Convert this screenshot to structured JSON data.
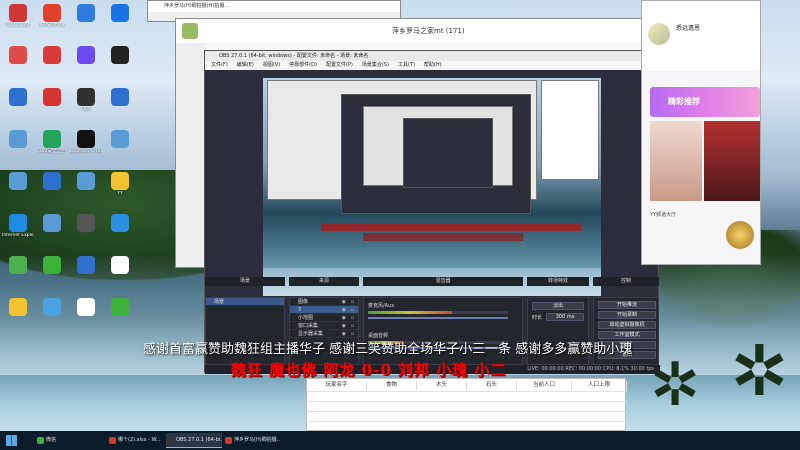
{
  "desktop_icons": [
    {
      "label": "Riot Client",
      "color": "#d13639"
    },
    {
      "label": "WPS Office",
      "color": "#e2412c"
    },
    {
      "label": "",
      "color": "#2f7de1"
    },
    {
      "label": "",
      "color": "#1a73e8"
    },
    {
      "label": "",
      "color": "#e04b4b"
    },
    {
      "label": "",
      "color": "#da3a3a"
    },
    {
      "label": "",
      "color": "#6a4cf0"
    },
    {
      "label": "",
      "color": "#222222"
    },
    {
      "label": "",
      "color": "#2f6fd0"
    },
    {
      "label": "",
      "color": "#d63333"
    },
    {
      "label": "OBS",
      "color": "#303030"
    },
    {
      "label": "",
      "color": "#2f6fd0"
    },
    {
      "label": "",
      "color": "#5b9bd5"
    },
    {
      "label": "360安全卫士",
      "color": "#23a35a"
    },
    {
      "label": "Logitech G HUB",
      "color": "#111111"
    },
    {
      "label": "",
      "color": "#5b9bd5"
    },
    {
      "label": "",
      "color": "#5b9bd5"
    },
    {
      "label": "",
      "color": "#2f6fd0"
    },
    {
      "label": "",
      "color": "#5b9bd5"
    },
    {
      "label": "YY",
      "color": "#f2c230"
    },
    {
      "label": "Internet Explorer",
      "color": "#1f8ae0"
    },
    {
      "label": "",
      "color": "#5b9bd5"
    },
    {
      "label": "",
      "color": "#555555"
    },
    {
      "label": "",
      "color": "#2b8fe0"
    },
    {
      "label": "",
      "color": "#4caf50"
    },
    {
      "label": "",
      "color": "#3db339"
    },
    {
      "label": "",
      "color": "#2f6fd0"
    },
    {
      "label": "",
      "color": "#ffffff"
    },
    {
      "label": "",
      "color": "#f2c230"
    },
    {
      "label": "",
      "color": "#4aa3df"
    },
    {
      "label": "",
      "color": "#ffffff"
    },
    {
      "label": "",
      "color": "#3db339"
    }
  ],
  "taskbar": {
    "items": [
      {
        "label": "哪个(2).xlsx - W...",
        "color": "#d63a2a"
      },
      {
        "label": "OBS 27.0.1 (64-bi...",
        "color": "#333333"
      },
      {
        "label": "萍乡罗马(H)卿拍摄...",
        "color": "#d63a2a"
      }
    ],
    "apps": [
      {
        "label": "微信",
        "color": "#3db339"
      }
    ]
  },
  "browser_window": {
    "title": "萍乡罗马(H)卿拍摄(H)拍摄...",
    "group_title": "萍乡罗马之家mt (171)"
  },
  "obs": {
    "title": "OBS 27.0.1 (64-bit, windows) - 配置文件: 未命名 - 场景: 未命名",
    "menu": [
      "文件(F)",
      "编辑(E)",
      "视图(V)",
      "停靠部件(D)",
      "配置文件(P)",
      "场景集合(S)",
      "工具(T)",
      "帮助(H)"
    ],
    "docks": {
      "scenes": "场景",
      "sources": "来源",
      "mixer": "混音器",
      "transitions": "转场特效",
      "controls": "控制"
    },
    "scene_name": "场景",
    "sources": [
      {
        "name": "图像"
      },
      {
        "name": "3"
      },
      {
        "name": "小地图"
      },
      {
        "name": "窗口采集"
      },
      {
        "name": "显示器采集"
      }
    ],
    "mixer": [
      {
        "name": "麦克风/Aux",
        "level": 0.6
      },
      {
        "name": "桌面音频",
        "level": 0.25
      }
    ],
    "controls": [
      "开始推流",
      "开始录制",
      "启动虚拟摄像机",
      "工作室模式",
      "设置",
      "退出"
    ],
    "transition": {
      "type": "淡出",
      "duration_label": "时长",
      "duration": "300 ms"
    },
    "status_bar": "LIVE: 00:00:00  REC: 00:00:00  CPU: 8.1%  30.00 fps"
  },
  "yy_panel": {
    "user_name": "悉远遗恩",
    "banner": "精彩推荐",
    "footer": "YY频道大厅"
  },
  "overlay": {
    "thanks_line": "感谢首富赢赞助魏狂组主播华子 感谢三笑赞助全场华子小三一条 感谢多多赢赞助小瑰",
    "score_line": "魏狂 魔也佛 阿龙 0-0 刘邦 小瑰 小二"
  },
  "sheet": {
    "headers": [
      "玩家名字",
      "食物",
      "木头",
      "石头",
      "当前人口",
      "人口上限"
    ]
  }
}
